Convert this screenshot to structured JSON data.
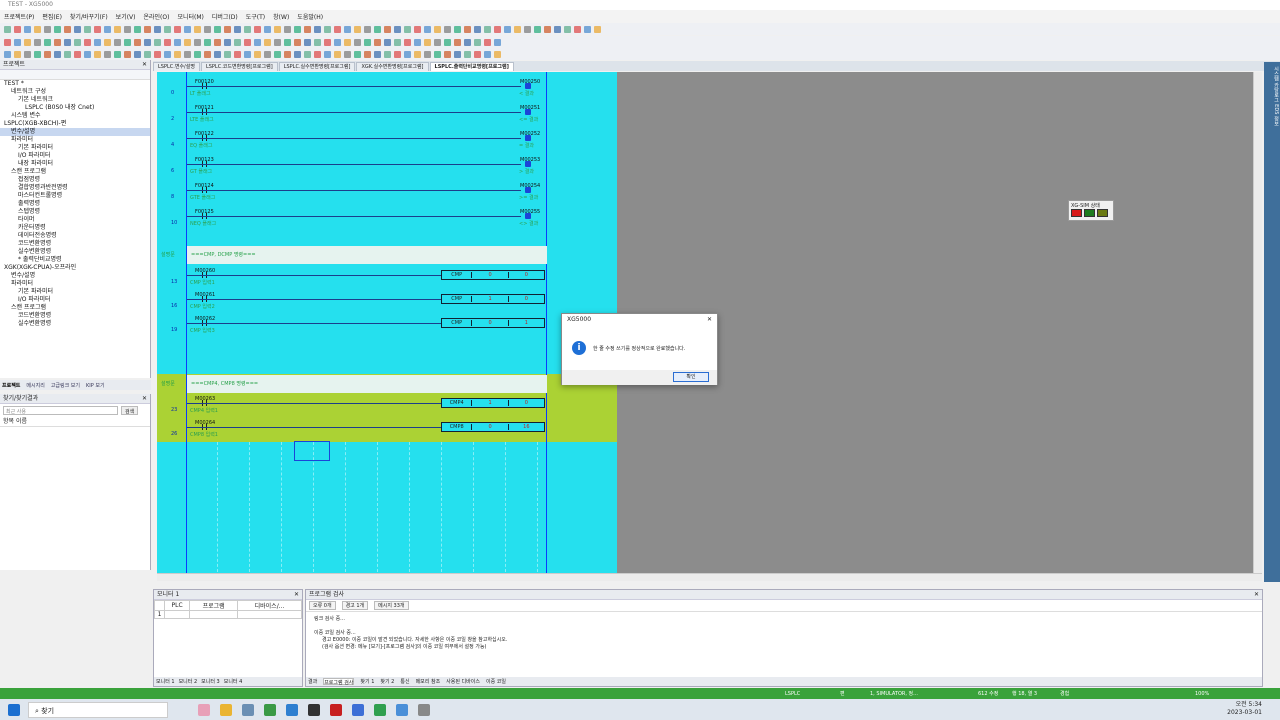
{
  "title": "TEST - XG5000",
  "menu": [
    "프로젝트(P)",
    "편집(E)",
    "찾기/바꾸기(F)",
    "보기(V)",
    "온라인(O)",
    "모니터(M)",
    "디버그(D)",
    "도구(T)",
    "창(W)",
    "도움말(H)"
  ],
  "project_panel": {
    "header": "프로젝트",
    "tree": [
      "TEST *",
      "네트워크 구성",
      "기본 네트워크",
      "LSPLC (B0S0 내장 Cnet)",
      "시스템 변수",
      "LSPLC(XGB-XBCH)-편",
      "변수/설명",
      "파라미터",
      "기본 파라미터",
      "I/O 파라미터",
      "내장 파라미터",
      "스캔 프로그램",
      "접점명령",
      "결합명령과반전명령",
      "마스터컨트롤명령",
      "출력명령",
      "스텝명령",
      "타이머",
      "카운터명령",
      "데이터전송명령",
      "코드변환명령",
      "실수변환명령",
      "* 출력단비교명령",
      "XGK(XGK-CPUA)-오프라인",
      "변수/설명",
      "파라미터",
      "기본 파라미터",
      "I/O 파라미터",
      "스캔 프로그램",
      "코드변환명령",
      "실수변환명령"
    ],
    "tabs": [
      "프로젝트",
      "메시지리",
      "고급링크 보기",
      "KIP 보기"
    ]
  },
  "search_panel": {
    "header": "찾기/찾기결과",
    "placeholder": "최근 사용",
    "button": "검색",
    "result_header": "항목 이름"
  },
  "doc_tabs": [
    "LSPLC.변수/설명",
    "LSPLC.코드변환명령[프로그램]",
    "LSPLC.실수변환명령[프로그램]",
    "XGK.실수변환명령[프로그램]",
    "LSPLC.출력단비교명령[프로그램]"
  ],
  "ladder": {
    "rungs": [
      {
        "num": "0",
        "addr": "F00120",
        "comment": "LT 플래그",
        "coil": "M00250",
        "coil_cmt": "< 결과"
      },
      {
        "num": "2",
        "addr": "F00121",
        "comment": "LTE 플래그",
        "coil": "M00251",
        "coil_cmt": "<= 결과"
      },
      {
        "num": "4",
        "addr": "F00122",
        "comment": "EQ 플래그",
        "coil": "M00252",
        "coil_cmt": "= 결과"
      },
      {
        "num": "6",
        "addr": "F00123",
        "comment": "GT 플래그",
        "coil": "M00253",
        "coil_cmt": "> 결과"
      },
      {
        "num": "8",
        "addr": "F00124",
        "comment": "GTE 플래그",
        "coil": "M00254",
        "coil_cmt": ">= 결과"
      },
      {
        "num": "10",
        "addr": "F00125",
        "comment": "NEQ 플래그",
        "coil": "M00255",
        "coil_cmt": "<> 결과"
      }
    ],
    "comment1_label": "설명문",
    "comment1": "===CMP, DCMP 명령===",
    "cmp_rungs": [
      {
        "num": "13",
        "addr": "M00260",
        "comment": "CMP 입력1",
        "fn": "CMP",
        "a": "0",
        "b": "0"
      },
      {
        "num": "16",
        "addr": "M00261",
        "comment": "CMP 입력2",
        "fn": "CMP",
        "a": "1",
        "b": "0"
      },
      {
        "num": "19",
        "addr": "M00262",
        "comment": "CMP 입력3",
        "fn": "CMP",
        "a": "0",
        "b": "1"
      }
    ],
    "comment2_label": "설명문",
    "comment2": "===CMP4, CMP8 명령===",
    "cmp48_rungs": [
      {
        "num": "23",
        "addr": "M00263",
        "comment": "CMP4 입력1",
        "fn": "CMP4",
        "a": "1",
        "b": "0"
      },
      {
        "num": "26",
        "addr": "M00264",
        "comment": "CMP8 입력1",
        "fn": "CMP8",
        "a": "0",
        "b": "16"
      }
    ]
  },
  "xgsim": {
    "title": "XG-SIM 상태",
    "lamps": [
      "#d81818",
      "#1e7b1e",
      "#6a7a12"
    ]
  },
  "dialog": {
    "title": "XG5000",
    "message": "한 줄 수정 쓰기를 정상적으로 완료했습니다.",
    "ok": "확인"
  },
  "right_strip": "시스템 카탈로그 EDS 정보",
  "monitor": {
    "header": "모니터 1",
    "cols": [
      "PLC",
      "프로그램",
      "디바이스/..."
    ],
    "row1": "1",
    "tabs": [
      "모니터 1",
      "모니터 2",
      "모니터 3",
      "모니터 4"
    ]
  },
  "check": {
    "header": "프로그램 검사",
    "buttons": [
      "오류 0개",
      "경고 1개",
      "메시지 33개"
    ],
    "lines": [
      "링크 검사 중...",
      "",
      "이중 코일 검사 중...",
      "경고 E0000: 이중 코일이 발견 되었습니다. 자세한 사항은 이중 코일 창을 참고하십시오.",
      "(검사 옵션 변경: 메뉴 [보기]-[프로그램 검사]의 이중 코일 여부에서 설정 가능)"
    ],
    "tabs": [
      "결과",
      "프로그램 검사",
      "찾기 1",
      "찾기 2",
      "통신",
      "메모리 참조",
      "사용된 디바이스",
      "이중 코일"
    ]
  },
  "status": {
    "plc": "LSPLC",
    "mode": "편",
    "conn": "1, SIMULATOR, 정...",
    "pos": "612 수정",
    "rowcol": "행 18, 열 3",
    "state": "경험",
    "zoom": "100%"
  },
  "taskbar": {
    "search": "찾기",
    "time": "오전 5:34",
    "date": "2023-03-01"
  }
}
